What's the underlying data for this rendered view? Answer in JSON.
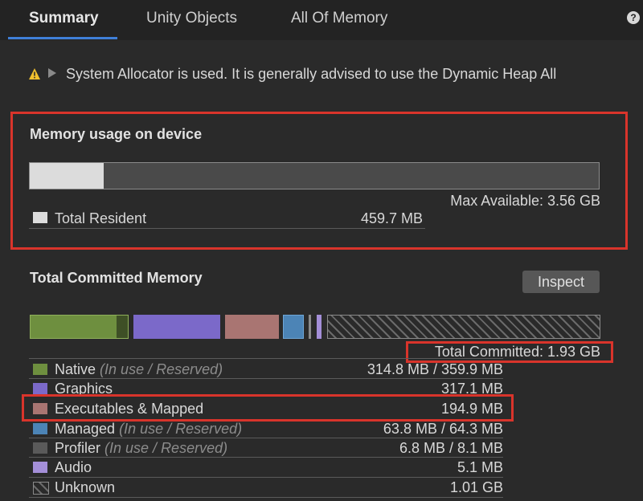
{
  "tabs": [
    {
      "label": "Summary",
      "active": true
    },
    {
      "label": "Unity Objects",
      "active": false
    },
    {
      "label": "All Of Memory",
      "active": false
    }
  ],
  "help_icon": "?",
  "warning": {
    "icon": "warning-triangle-icon",
    "text": "System Allocator is used. It is generally advised to use the Dynamic Heap All"
  },
  "device_usage": {
    "title": "Memory usage on device",
    "max_available": "Max Available: 3.56 GB",
    "resident_fraction": 0.13,
    "legend_label": "Total Resident",
    "legend_value": "459.7 MB"
  },
  "committed": {
    "title": "Total Committed Memory",
    "inspect_label": "Inspect",
    "total_label": "Total Committed: 1.93 GB",
    "rows": [
      {
        "label": "Native",
        "note": "(In use / Reserved)",
        "value": "314.8 MB / 359.9 MB",
        "color": "#6e8f3f"
      },
      {
        "label": "Graphics",
        "note": "",
        "value": "317.1 MB",
        "color": "#7b69c9"
      },
      {
        "label": "Executables & Mapped",
        "note": "",
        "value": "194.9 MB",
        "color": "#a97572"
      },
      {
        "label": "Managed",
        "note": "(In use / Reserved)",
        "value": "63.8 MB / 64.3 MB",
        "color": "#4c84b6"
      },
      {
        "label": "Profiler",
        "note": "(In use / Reserved)",
        "value": "6.8 MB / 8.1 MB",
        "color": "#5a5a5a"
      },
      {
        "label": "Audio",
        "note": "",
        "value": "5.1 MB",
        "color": "#a48fd8"
      },
      {
        "label": "Unknown",
        "note": "",
        "value": "1.01 GB",
        "color": "hatched"
      }
    ]
  }
}
